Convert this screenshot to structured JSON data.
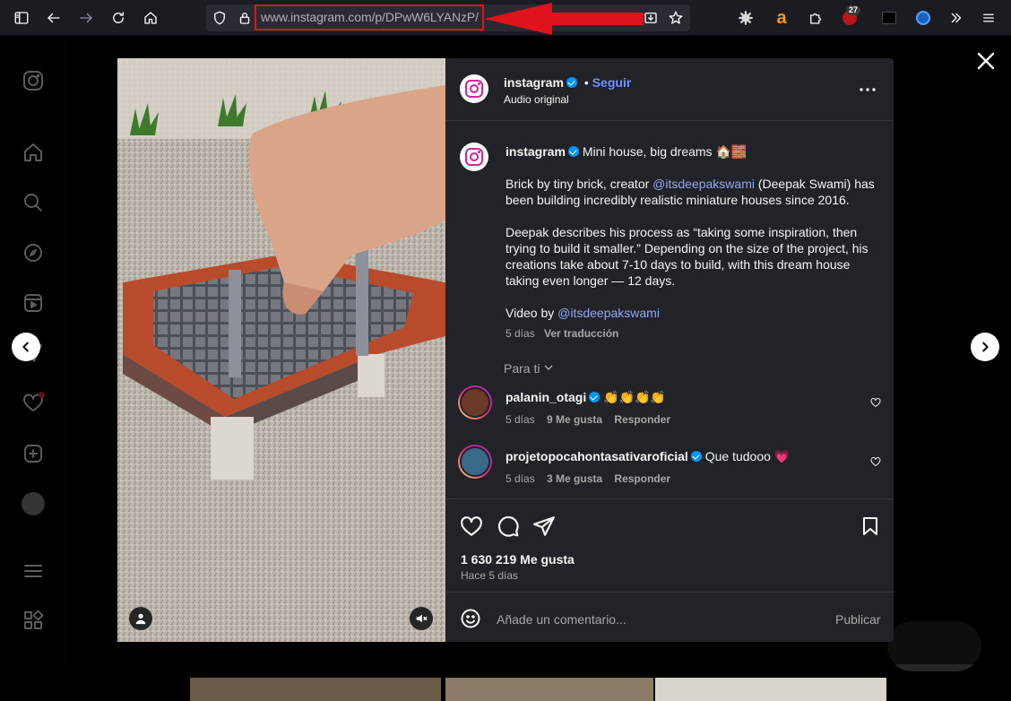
{
  "browser": {
    "url_host": "www.instagram.com",
    "url_path": "/p/DPwW6LYANzP/",
    "ext_badge_count": "27",
    "icons": [
      "sidebar-toggle-icon",
      "back-icon",
      "forward-icon",
      "reload-icon",
      "home-icon",
      "shield-icon",
      "lock-icon",
      "reader-view-icon",
      "bookmark-star-icon",
      "gear-extension-icon",
      "amazon-extension-icon",
      "puzzle-icon",
      "extension-badge-icon",
      "extension-dark-icon",
      "extension-blue-icon",
      "overflow-icon",
      "menu-icon"
    ]
  },
  "post": {
    "author": "instagram",
    "follow_label": "Seguir",
    "audio_label": "Audio original",
    "caption_title": "Mini house, big dreams 🏠🧱",
    "caption_p1_pre": "Brick by tiny brick, creator ",
    "caption_mention": "@itsdeepakswami",
    "caption_p1_post": " (Deepak Swami) has",
    "caption_p1_line2": "been building incredibly realistic miniature houses since 2016.",
    "caption_p2_l1": "Deepak describes his process as “taking some inspiration, then",
    "caption_p2_l2": "trying to build it smaller.” Depending on the size of the project, his",
    "caption_p2_l3": "creations take about 7-10 days to build, with this dream house",
    "caption_p2_l4": "taking even longer — 12 days.",
    "video_by_label": "Video by ",
    "video_by_mention": "@itsdeepakswami",
    "caption_age": "5 días",
    "translate_label": "Ver traducción",
    "for_you_label": "Para ti",
    "likes": "1 630 219 Me gusta",
    "posted": "Hace 5 días",
    "comment_placeholder": "Añade un comentario...",
    "publish_label": "Publicar"
  },
  "comments": [
    {
      "user": "palanin_otagi",
      "text": "👏👏👏👏",
      "age": "5 días",
      "likes": "9 Me gusta",
      "reply": "Responder"
    },
    {
      "user": "projetopocahontasativaroficial",
      "text": "Que tudooo 💗",
      "age": "5 días",
      "likes": "3 Me gusta",
      "reply": "Responder"
    }
  ],
  "colors": {
    "accent": "#0095f6",
    "link": "#8fa9f5",
    "panel": "#212328",
    "url_highlight": "#e0121b"
  }
}
